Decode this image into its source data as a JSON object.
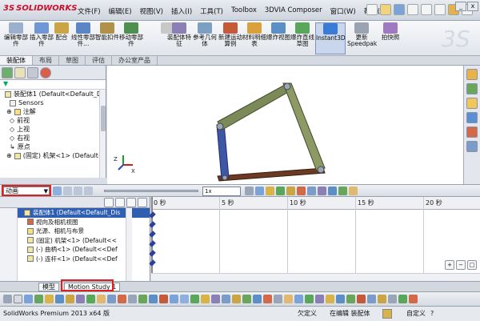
{
  "app": {
    "logo_prefix": "3S",
    "logo": "SOLIDWORKS",
    "menu": [
      "文件(F)",
      "编辑(E)",
      "视图(V)",
      "插入(I)",
      "工具(T)",
      "Toolbox",
      "3DVIA Composer",
      "窗口(W)",
      "帮助(H)"
    ]
  },
  "commands": [
    {
      "label": "编辑零部件",
      "color": "#9ab0cc"
    },
    {
      "label": "插入零部件",
      "color": "#6f97d6"
    },
    {
      "label": "配合",
      "color": "#c9a546"
    },
    {
      "label": "线性零部件...",
      "color": "#5a86c8"
    },
    {
      "label": "智能扣件",
      "color": "#b0914a"
    },
    {
      "label": "移动零部件",
      "color": "#4f8f4f"
    },
    {
      "label": "装配体特征",
      "color": "#8c7fb5"
    },
    {
      "label": "参考几何体",
      "color": "#7c9fc4"
    },
    {
      "label": "新建运动算例",
      "color": "#c45a3a"
    },
    {
      "label": "材料明细表",
      "color": "#d9a13b"
    },
    {
      "label": "爆炸视图",
      "color": "#5c8fc5"
    },
    {
      "label": "爆炸直线草图",
      "color": "#5aa65a"
    },
    {
      "label": "Instant3D",
      "color": "#3a7bd5"
    },
    {
      "label": "更新Speedpak",
      "color": "#9aa3b0"
    },
    {
      "label": "拍快照",
      "color": "#a07ac0"
    }
  ],
  "command_tabs": [
    "装配体",
    "布局",
    "草图",
    "评估",
    "办公室产品"
  ],
  "feature_tree": [
    "装配体1 (Default<Default_D",
    "Sensors",
    "注解",
    "前视",
    "上视",
    "右视",
    "原点",
    "(固定) 机架<1> (Default<"
  ],
  "motion": {
    "study_type": "动画",
    "speed": "1x"
  },
  "motion_tree": [
    "装配体1 (Default<Default_Dis",
    "视向及相机视图",
    "光源、相机与布景",
    "(固定) 机架<1> (Default<<",
    "(-) 曲柄<1> (Default<<Def",
    "(-) 连杆<1> (Default<<Def"
  ],
  "timeline": {
    "ticks": [
      "0 秒",
      "5 秒",
      "10 秒",
      "15 秒",
      "20 秒"
    ]
  },
  "study_tabs": [
    "模型",
    "Motion Study 1"
  ],
  "status": {
    "product": "SolidWorks Premium 2013 x64 版",
    "state": "欠定义",
    "editing": "在编辑 装配体",
    "custom": "自定义",
    "help": "?"
  },
  "colors": {
    "red_highlight": "#e02020",
    "link_dark": "#5f6f3f",
    "link_blue": "#3d57a6",
    "selection": "#2f5fb3"
  }
}
